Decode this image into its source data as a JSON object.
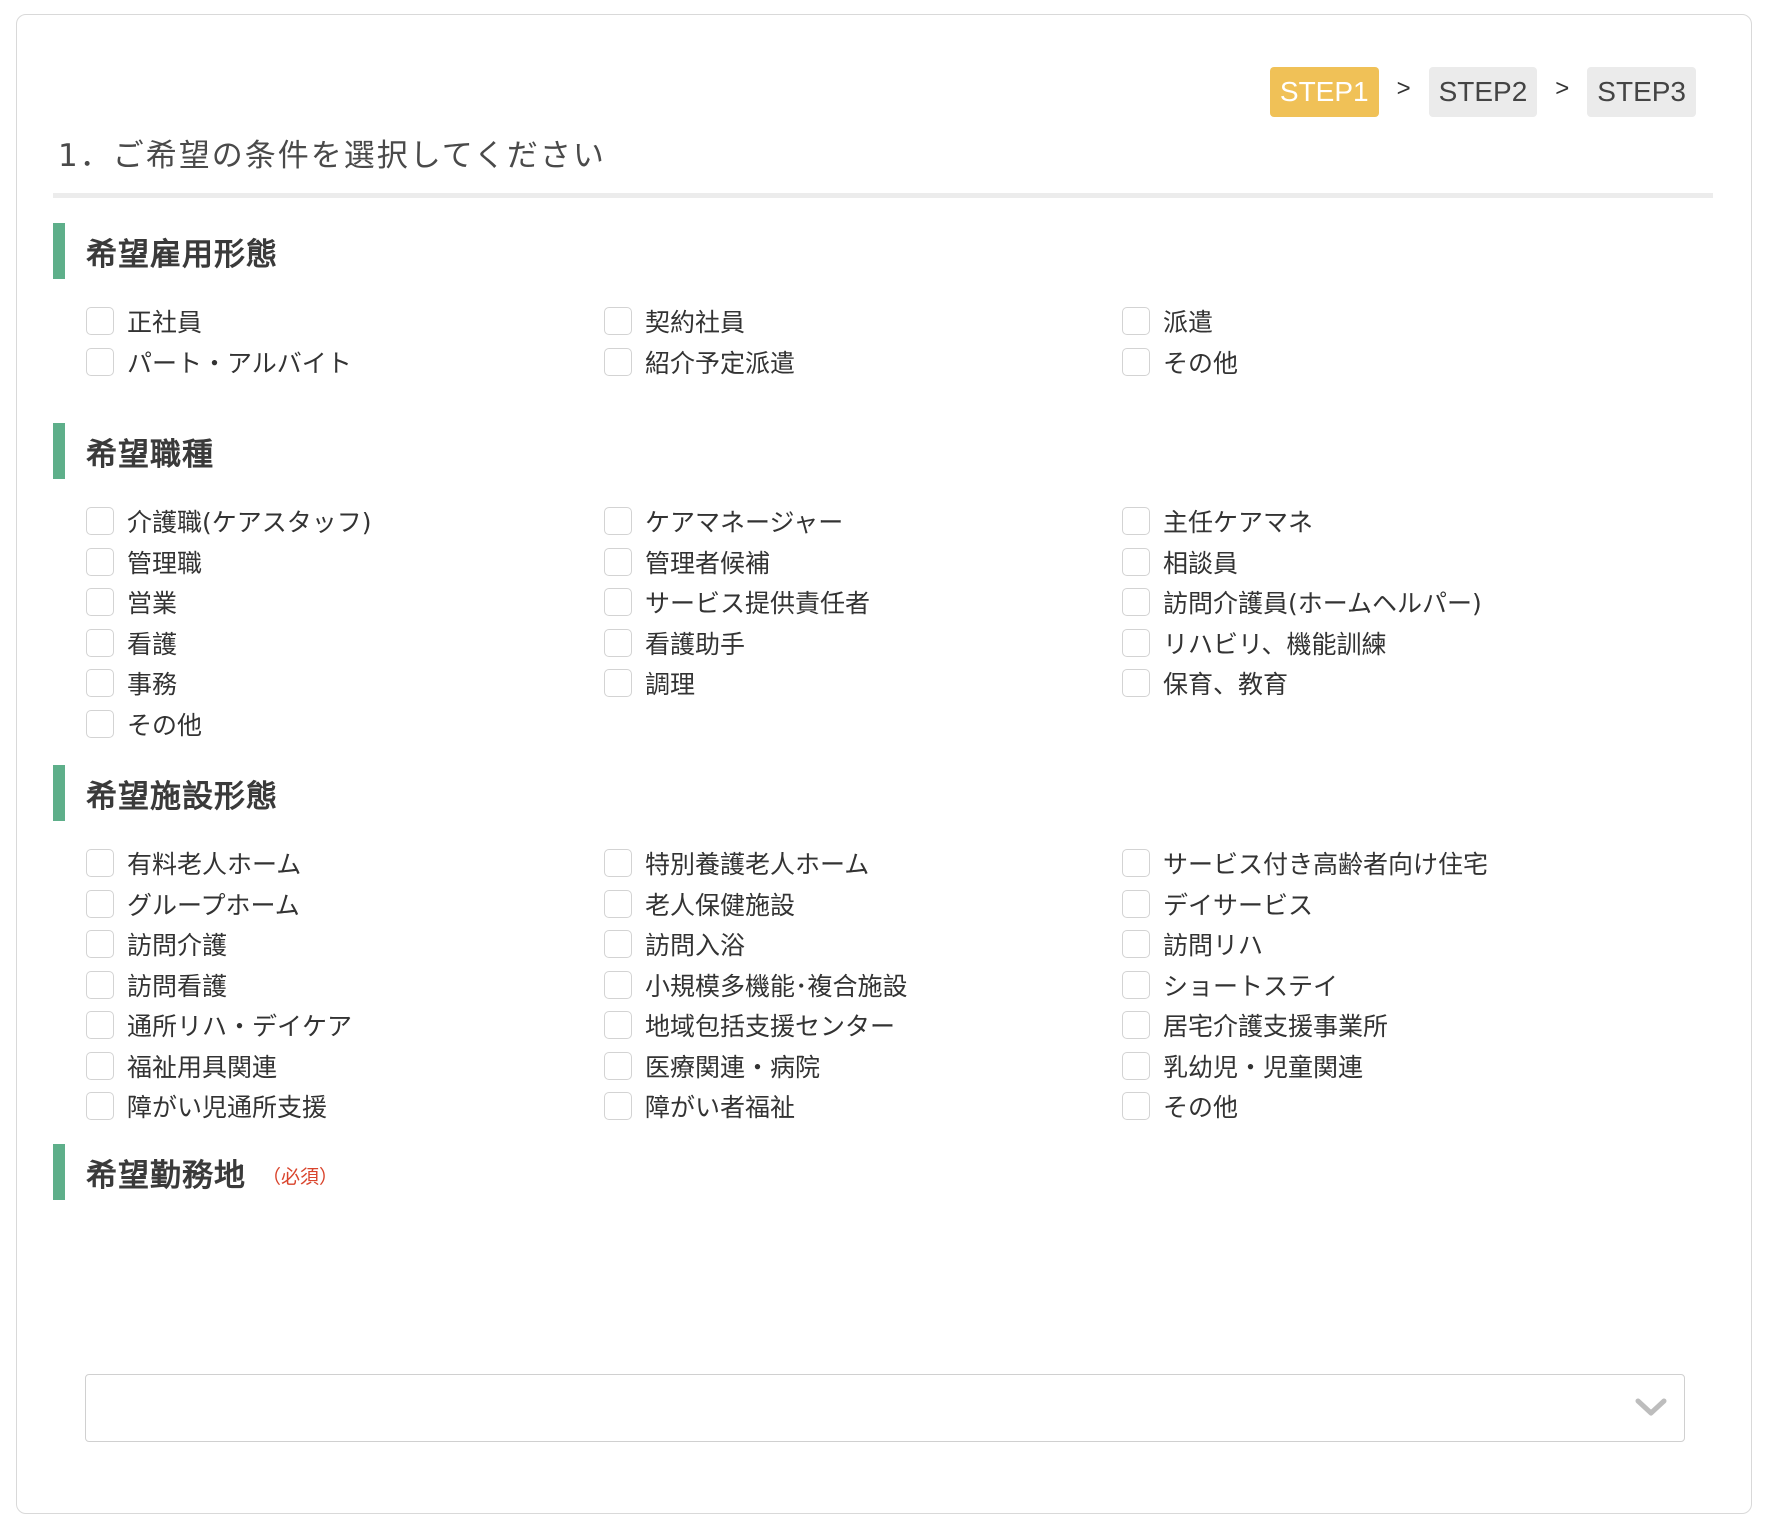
{
  "steps": {
    "step1": "STEP1",
    "sep1": ">",
    "step2": "STEP2",
    "sep2": ">",
    "step3": "STEP3"
  },
  "page_title": "1．ご希望の条件を選択してください",
  "sections": {
    "employment": {
      "title": "希望雇用形態",
      "options": [
        "正社員",
        "契約社員",
        "派遣",
        "パート・アルバイト",
        "紹介予定派遣",
        "その他"
      ]
    },
    "job_type": {
      "title": "希望職種",
      "options": [
        "介護職(ケアスタッフ)",
        "ケアマネージャー",
        "主任ケアマネ",
        "管理職",
        "管理者候補",
        "相談員",
        "営業",
        "サービス提供責任者",
        "訪問介護員(ホームヘルパー)",
        "看護",
        "看護助手",
        "リハビリ、機能訓練",
        "事務",
        "調理",
        "保育、教育",
        "その他"
      ]
    },
    "facility": {
      "title": "希望施設形態",
      "options": [
        "有料老人ホーム",
        "特別養護老人ホーム",
        "サービス付き高齢者向け住宅",
        "グループホーム",
        "老人保健施設",
        "デイサービス",
        "訪問介護",
        "訪問入浴",
        "訪問リハ",
        "訪問看護",
        "小規模多機能･複合施設",
        "ショートステイ",
        "通所リハ・デイケア",
        "地域包括支援センター",
        "居宅介護支援事業所",
        "福祉用具関連",
        "医療関連・病院",
        "乳幼児・児童関連",
        "障がい児通所支援",
        "障がい者福祉",
        "その他"
      ]
    },
    "location": {
      "title": "希望勤務地",
      "required_label": "（必須）",
      "select_value": ""
    }
  },
  "icons": {
    "select": "chevron-down-icon"
  },
  "colors": {
    "step_active": "#f0c157",
    "step_inactive": "#ebebeb",
    "section_accent": "#5eaf8a",
    "required": "#d9442c"
  }
}
